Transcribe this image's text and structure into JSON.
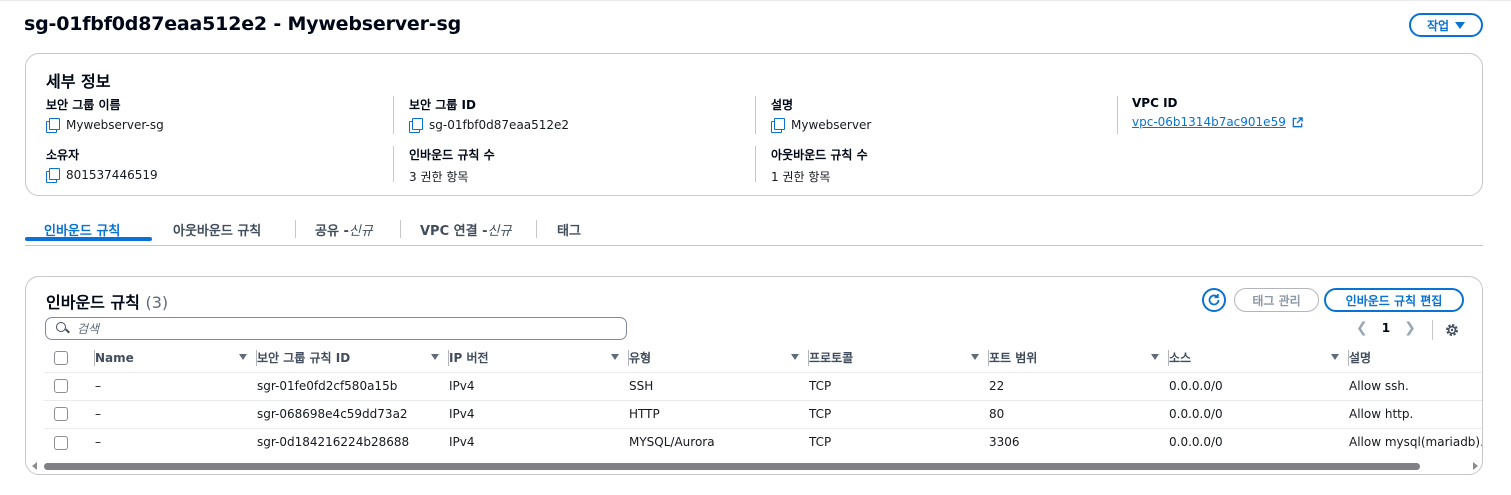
{
  "header": {
    "title": "sg-01fbf0d87eaa512e2 - Mywebserver-sg",
    "actions_label": "작업"
  },
  "details": {
    "title": "세부 정보",
    "fields": {
      "sg_name": {
        "label": "보안 그룹 이름",
        "value": "Mywebserver-sg"
      },
      "sg_id": {
        "label": "보안 그룹 ID",
        "value": "sg-01fbf0d87eaa512e2"
      },
      "description": {
        "label": "설명",
        "value": "Mywebserver"
      },
      "vpc_id": {
        "label": "VPC ID",
        "value": "vpc-06b1314b7ac901e59"
      },
      "owner": {
        "label": "소유자",
        "value": "801537446519"
      },
      "inbound_count": {
        "label": "인바운드 규칙 수",
        "value": "3 권한 항목"
      },
      "outbound_count": {
        "label": "아웃바운드 규칙 수",
        "value": "1 권한 항목"
      }
    }
  },
  "tabs": [
    {
      "label": "인바운드 규칙",
      "suffix": ""
    },
    {
      "label": "아웃바운드 규칙",
      "suffix": ""
    },
    {
      "label": "공유 - ",
      "suffix": "신규"
    },
    {
      "label": "VPC 연결 - ",
      "suffix": "신규"
    },
    {
      "label": "태그",
      "suffix": ""
    }
  ],
  "rules_panel": {
    "title": "인바운드 규칙",
    "count": "(3)",
    "tag_manage_label": "태그 관리",
    "edit_label": "인바운드 규칙 편집",
    "search_placeholder": "검색",
    "page": "1",
    "columns": [
      "Name",
      "보안 그룹 규칙 ID",
      "IP 버전",
      "유형",
      "프로토콜",
      "포트 범위",
      "소스",
      "설명"
    ],
    "rows": [
      {
        "name": "–",
        "rule_id": "sgr-01fe0fd2cf580a15b",
        "ip": "IPv4",
        "type": "SSH",
        "protocol": "TCP",
        "port": "22",
        "source": "0.0.0.0/0",
        "desc": "Allow ssh."
      },
      {
        "name": "–",
        "rule_id": "sgr-068698e4c59dd73a2",
        "ip": "IPv4",
        "type": "HTTP",
        "protocol": "TCP",
        "port": "80",
        "source": "0.0.0.0/0",
        "desc": "Allow http."
      },
      {
        "name": "–",
        "rule_id": "sgr-0d184216224b28688",
        "ip": "IPv4",
        "type": "MYSQL/Aurora",
        "protocol": "TCP",
        "port": "3306",
        "source": "0.0.0.0/0",
        "desc": "Allow mysql(mariadb)."
      }
    ]
  },
  "colors": {
    "accent": "#0972d3",
    "border": "#c6c6cd"
  }
}
